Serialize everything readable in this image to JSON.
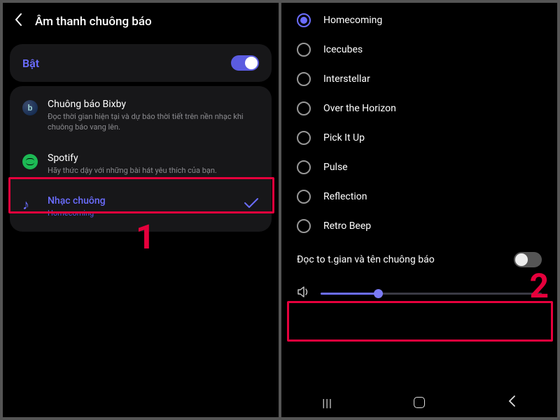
{
  "left": {
    "header_title": "Âm thanh chuông báo",
    "on_label": "Bật",
    "bixby": {
      "title": "Chuông báo Bixby",
      "sub": "Đọc thời gian hiện tại và dự báo thời tiết trên nền nhạc khi chuông báo vang lên."
    },
    "spotify": {
      "title": "Spotify",
      "sub": "Hãy thức dậy với những bài hát yêu thích của bạn."
    },
    "ringtone": {
      "title": "Nhạc chuông",
      "sub": "Homecoming"
    },
    "step_label": "1"
  },
  "right": {
    "tones": [
      {
        "name": "Homecoming",
        "selected": true
      },
      {
        "name": "Icecubes",
        "selected": false
      },
      {
        "name": "Interstellar",
        "selected": false
      },
      {
        "name": "Over the Horizon",
        "selected": false
      },
      {
        "name": "Pick It Up",
        "selected": false
      },
      {
        "name": "Pulse",
        "selected": false
      },
      {
        "name": "Reflection",
        "selected": false
      },
      {
        "name": "Retro Beep",
        "selected": false
      }
    ],
    "tts_label": "Đọc to t.gian và tên chuông báo",
    "step_label": "2"
  }
}
